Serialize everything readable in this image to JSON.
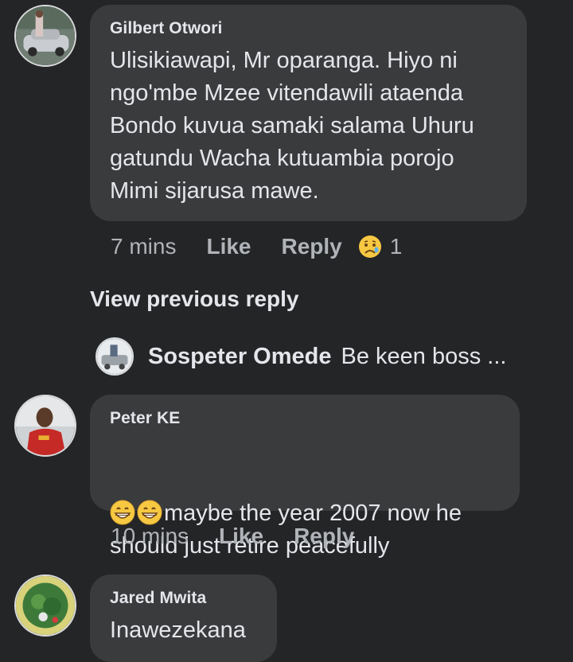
{
  "comments": [
    {
      "author": "Gilbert Otwori",
      "text": "Ulisikiawapi, Mr oparanga. Hiyo ni\nngo'mbe Mzee vitendawili ataenda\nBondo kuvua samaki salama Uhuru\ngatundu Wacha kutuambia porojo\nMimi sijarusa mawe.",
      "time": "7 mins",
      "like_label": "Like",
      "reply_label": "Reply",
      "reaction_icon": "sad-emoji-icon",
      "reaction_count": "1"
    },
    {
      "author": "Peter KE",
      "text": "maybe the year 2007 now he\nshould just retire peacefully",
      "emoji_icons": [
        "grinning-emoji-icon",
        "grinning-emoji-icon"
      ],
      "time": "10 mins",
      "like_label": "Like",
      "reply_label": "Reply"
    },
    {
      "author": "Jared Mwita",
      "text": "Inawezekana"
    }
  ],
  "view_previous_reply": "View previous reply",
  "reply_preview": {
    "author": "Sospeter Omede",
    "text": "Be keen boss ..."
  }
}
